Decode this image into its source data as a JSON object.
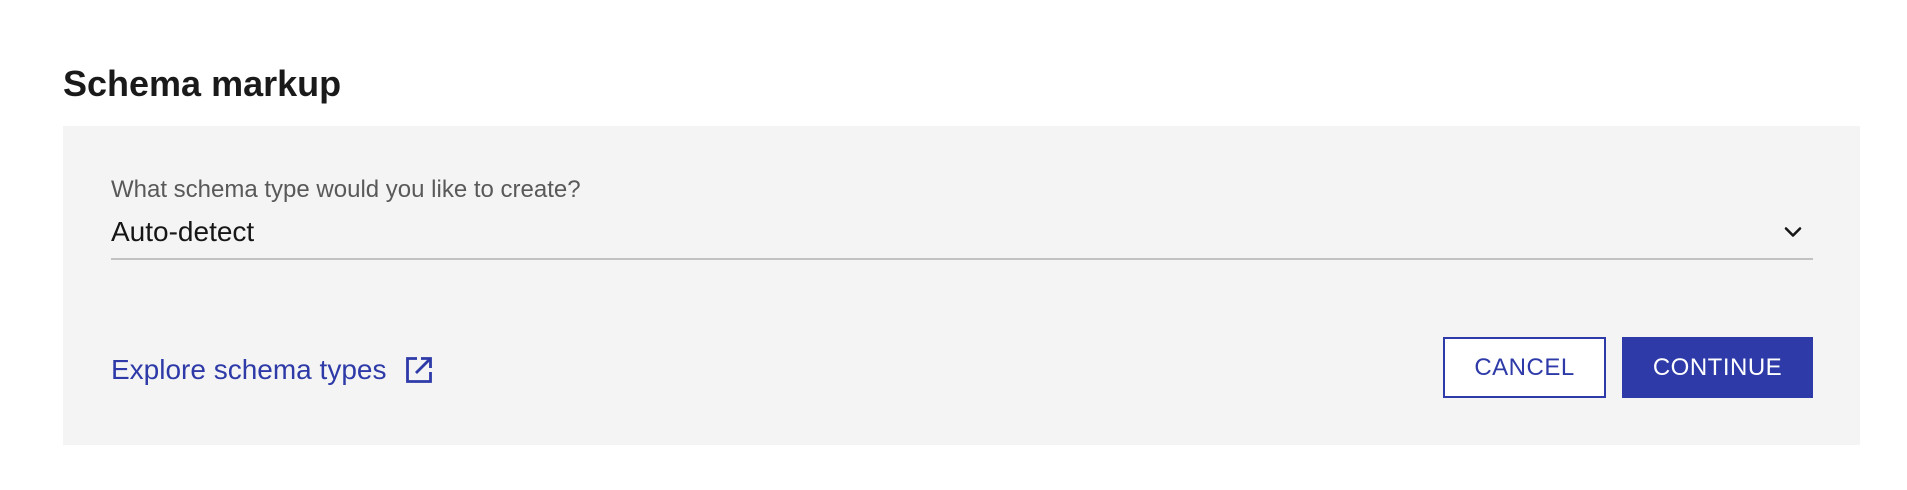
{
  "page": {
    "title": "Schema markup"
  },
  "form": {
    "schema_type_label": "What schema type would you like to create?",
    "schema_type_value": "Auto-detect",
    "explore_link_text": "Explore schema types",
    "cancel_label": "CANCEL",
    "continue_label": "CONTINUE"
  },
  "icons": {
    "dropdown": "chevron-down-icon",
    "external_link": "external-link-icon"
  },
  "colors": {
    "accent": "#2d3aa8",
    "panel_background": "#f4f4f4",
    "label_text": "#595959",
    "divider": "#c2c2c2"
  }
}
